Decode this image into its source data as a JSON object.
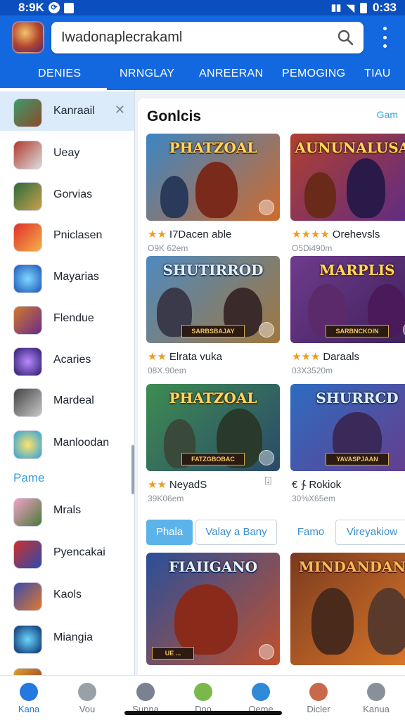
{
  "status": {
    "left_text": "8:9K",
    "time": "0:33"
  },
  "search": {
    "value": "Iwadonaplecrakaml"
  },
  "tabs": [
    "DENIES",
    "NRNGLAY",
    "ANREERAN",
    "PEMOGING",
    "TIAU"
  ],
  "sidebar": {
    "items": [
      {
        "label": "Kanraail",
        "active": true
      },
      {
        "label": "Ueay"
      },
      {
        "label": "Gorvias"
      },
      {
        "label": "Pniclasen"
      },
      {
        "label": "Mayarias"
      },
      {
        "label": "Flendue"
      },
      {
        "label": "Acaries"
      },
      {
        "label": "Mardeal"
      },
      {
        "label": "Manloodan"
      }
    ],
    "section_label": "Pame",
    "items2": [
      {
        "label": "Mrals"
      },
      {
        "label": "Pyencakai"
      },
      {
        "label": "Kaols"
      },
      {
        "label": "Miangia"
      }
    ]
  },
  "main": {
    "title": "Gonlcis",
    "link": "Gam",
    "cards": [
      {
        "art": "PHATZOAL",
        "name": "I7Dacen able",
        "stars": "★★",
        "meta": "O9K 62em",
        "colors": [
          "#3b86c4",
          "#d06a2d"
        ]
      },
      {
        "art": "AUNUNALUSAS",
        "name": "Orehevsls",
        "stars": "★★★★",
        "meta": "O5Di490m",
        "colors": [
          "#b0402e",
          "#5a2a8a"
        ]
      },
      {
        "art": "SHUTIRROD",
        "banner": "SARBSBAJAY",
        "name": "Elrata vuka",
        "stars": "★★",
        "meta": "08X.90em",
        "colors": [
          "#4f8ac0",
          "#a1763d"
        ]
      },
      {
        "art": "MARPLIS",
        "banner": "SARBNCKOIN",
        "name": "Daraals",
        "stars": "★★★",
        "meta": "03X3520m",
        "colors": [
          "#6e3b8e",
          "#3b1f55"
        ]
      },
      {
        "art": "PHATZOAL",
        "banner": "FATZGBOBAC",
        "name": "NeyadS",
        "stars": "★★",
        "meta": "39K06em",
        "download": "⍗",
        "colors": [
          "#3e8c52",
          "#2a4a6a"
        ]
      },
      {
        "art": "SHURRCD",
        "banner": "YAVASPJAAN",
        "name": "Rokiok",
        "stars": "€ ∱",
        "meta": "30%X65em",
        "download": "⋮",
        "colors": [
          "#2d6cc0",
          "#6a3a8a"
        ]
      },
      {
        "art": "FIAIIGANO",
        "banner": "UE ...",
        "name": "",
        "stars": "",
        "meta": "",
        "colors": [
          "#2a4f9a",
          "#c0502d"
        ]
      },
      {
        "art": "MINDANDANS",
        "name": "",
        "stars": "",
        "meta": "",
        "colors": [
          "#7a3a1f",
          "#e07a2a"
        ]
      }
    ],
    "chips_left": [
      "Phala",
      "Valay a Bany"
    ],
    "chips_right": [
      "Famo",
      "Vireyakiow"
    ]
  },
  "bottom_nav": [
    {
      "label": "Kana",
      "active": true,
      "color": "#2479e0"
    },
    {
      "label": "Vou",
      "color": "#9aa0a8"
    },
    {
      "label": "Sunna",
      "color": "#7a8290"
    },
    {
      "label": "Dno",
      "color": "#7ab84a"
    },
    {
      "label": "Oeme",
      "color": "#2f8ad8"
    },
    {
      "label": "Dicler",
      "color": "#c86a4a"
    },
    {
      "label": "Kanua",
      "color": "#8a909a"
    }
  ]
}
